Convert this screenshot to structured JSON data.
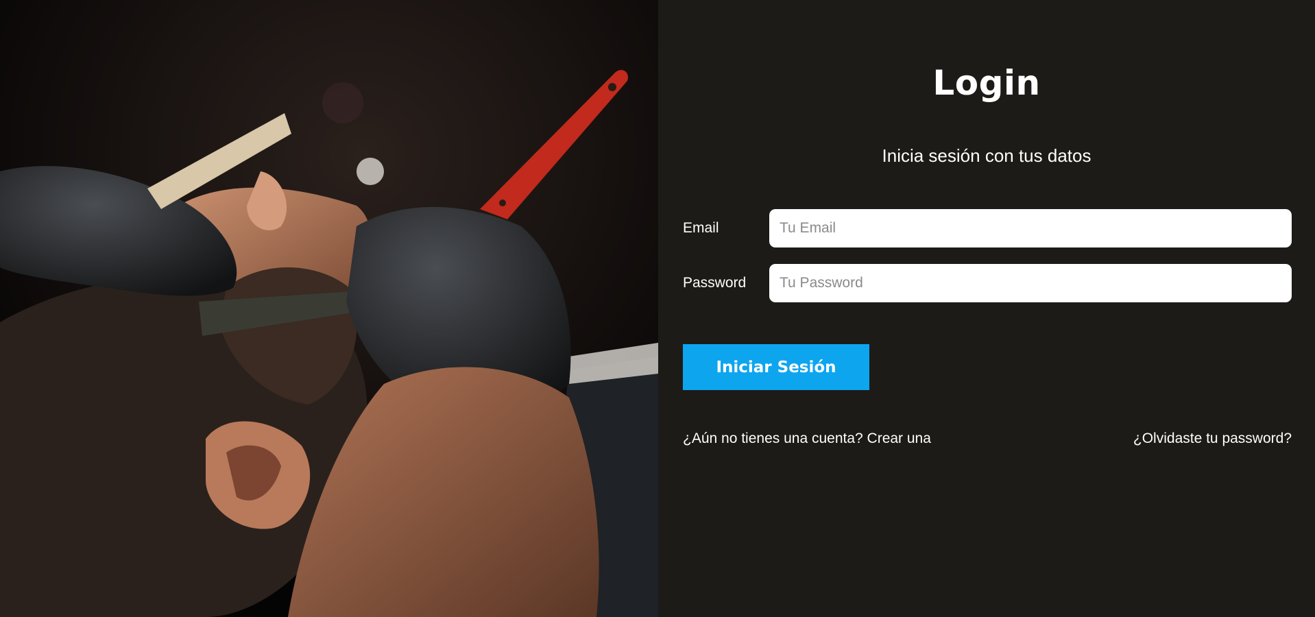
{
  "hero": {
    "image": "barber shaving a bearded man with a straight razor, black gloves"
  },
  "login": {
    "title": "Login",
    "subtitle": "Inicia sesión con tus datos",
    "email": {
      "label": "Email",
      "placeholder": "Tu Email",
      "value": ""
    },
    "password": {
      "label": "Password",
      "placeholder": "Tu Password",
      "value": ""
    },
    "submit_label": "Iniciar Sesión",
    "create_account_link": "¿Aún no tienes una cuenta? Crear una",
    "forgot_password_link": "¿Olvidaste tu password?"
  },
  "colors": {
    "panel_bg": "#1c1b17",
    "accent": "#0ea5ef",
    "text": "#ffffff",
    "input_bg": "#ffffff"
  }
}
